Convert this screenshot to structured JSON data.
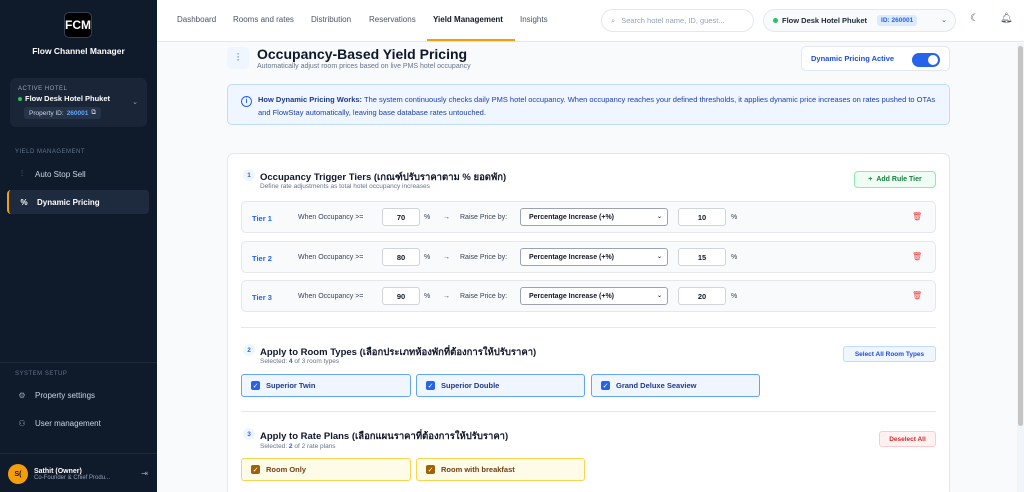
{
  "sidebar": {
    "logo_text": "FCM",
    "app_name": "Flow Channel Manager",
    "active_hotel_label": "ACTIVE HOTEL",
    "hotel_name": "Flow Desk Hotel Phuket",
    "property_id_label": "Property ID:",
    "property_id": "260001",
    "yield_section": "YIELD MANAGEMENT",
    "yield_items": [
      {
        "label": "Auto Stop Sell",
        "icon": "sliders-icon"
      },
      {
        "label": "Dynamic Pricing",
        "icon": "percent-icon",
        "active": true
      }
    ],
    "setup_section": "SYSTEM SETUP",
    "setup_items": [
      {
        "label": "Property settings",
        "icon": "gear-icon"
      },
      {
        "label": "User management",
        "icon": "users-icon"
      }
    ],
    "user": {
      "initials": "S(",
      "name": "Sathit (Owner)",
      "role": "Co-Founder & Chief Produ..."
    }
  },
  "topnav": {
    "tabs": [
      "Dashboard",
      "Rooms and rates",
      "Distribution",
      "Reservations",
      "Yield Management",
      "Insights"
    ],
    "active_tab": "Yield Management",
    "search_placeholder": "Search hotel name, ID, guest...",
    "hotel_name": "Flow Desk Hotel Phuket",
    "hotel_id": "ID: 260001"
  },
  "page": {
    "title": "Occupancy-Based Yield Pricing",
    "subtitle": "Automatically adjust room prices based on live PMS hotel occupancy",
    "toggle_label": "Dynamic Pricing Active",
    "toggle_on": true
  },
  "info": {
    "heading": "How Dynamic Pricing Works:",
    "body": " The system continuously checks daily PMS hotel occupancy. When occupancy reaches your defined thresholds, it applies dynamic price increases on rates pushed to OTAs and FlowStay automatically, leaving base database rates untouched."
  },
  "tiers_section": {
    "step": "1",
    "title": "Occupancy Trigger Tiers (เกณฑ์ปรับราคาตาม % ยอดพัก)",
    "subtitle": "Define rate adjustments as total hotel occupancy increases",
    "add_button": "Add Rule Tier",
    "when_label": "When Occupancy >=",
    "percent": "%",
    "arrow": "→",
    "raise_label": "Raise Price by:",
    "tiers": [
      {
        "name": "Tier 1",
        "occupancy": "70",
        "method": "Percentage Increase (+%)",
        "amount": "10"
      },
      {
        "name": "Tier 2",
        "occupancy": "80",
        "method": "Percentage Increase (+%)",
        "amount": "15"
      },
      {
        "name": "Tier 3",
        "occupancy": "90",
        "method": "Percentage Increase (+%)",
        "amount": "20"
      }
    ]
  },
  "rooms_section": {
    "step": "2",
    "title": "Apply to Room Types (เลือกประเภทห้องพักที่ต้องการให้ปรับราคา)",
    "selected_prefix": "Selected: ",
    "selected_count": "4",
    "selected_suffix": " of 3 room types",
    "select_all": "Select All Room Types",
    "items": [
      "Superior Twin",
      "Superior Double",
      "Grand Deluxe Seaview"
    ]
  },
  "rates_section": {
    "step": "3",
    "title": "Apply to Rate Plans (เลือกแผนราคาที่ต้องการให้ปรับราคา)",
    "selected_prefix": "Selected: ",
    "selected_count": "2",
    "selected_suffix": " of 2 rate plans",
    "deselect_all": "Deselect All",
    "items": [
      "Room Only",
      "Room with breakfast"
    ]
  },
  "colors": {
    "sidebar_bg": "#0f1a2b",
    "accent": "#f59e0b",
    "primary": "#2563eb"
  }
}
